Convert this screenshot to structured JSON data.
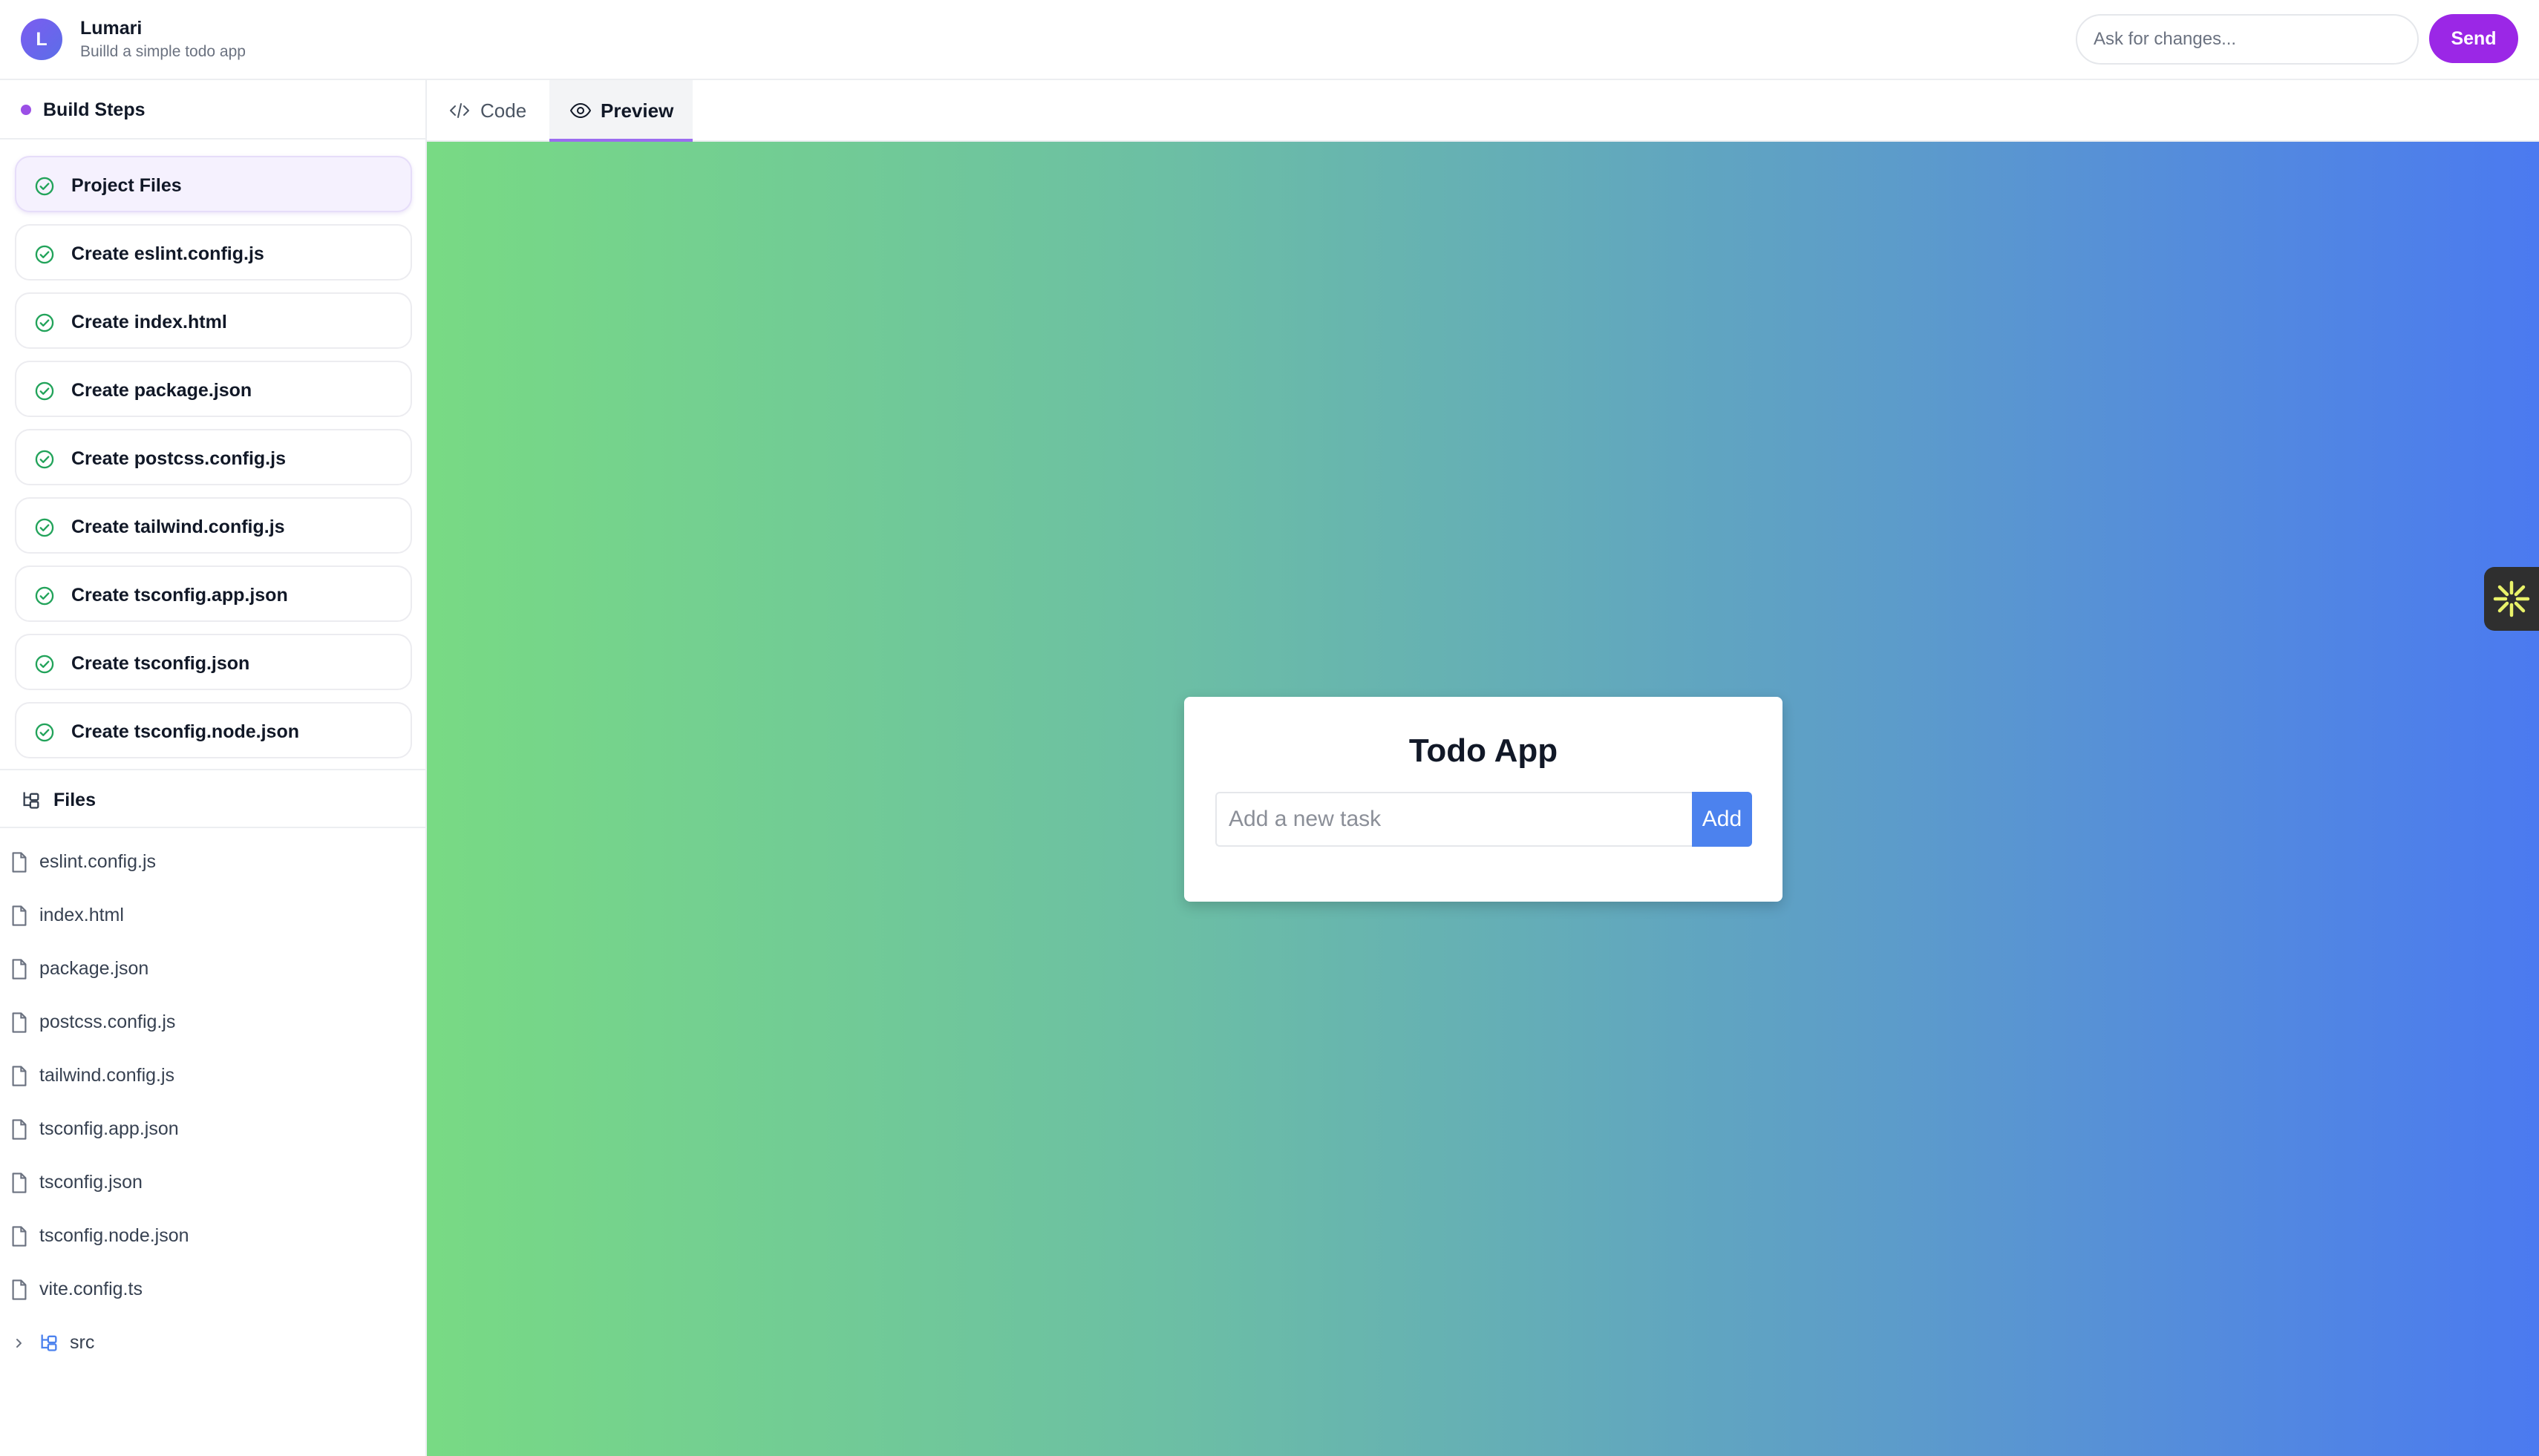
{
  "header": {
    "avatar_letter": "L",
    "app_name": "Lumari",
    "app_subtitle": "Builld a simple todo app",
    "ask_placeholder": "Ask for changes...",
    "send_label": "Send"
  },
  "build_steps": {
    "title": "Build Steps",
    "items": [
      {
        "label": "Project Files",
        "status": "done",
        "active": true
      },
      {
        "label": "Create eslint.config.js",
        "status": "done"
      },
      {
        "label": "Create index.html",
        "status": "done"
      },
      {
        "label": "Create package.json",
        "status": "done"
      },
      {
        "label": "Create postcss.config.js",
        "status": "done"
      },
      {
        "label": "Create tailwind.config.js",
        "status": "done"
      },
      {
        "label": "Create tsconfig.app.json",
        "status": "done"
      },
      {
        "label": "Create tsconfig.json",
        "status": "done"
      },
      {
        "label": "Create tsconfig.node.json",
        "status": "done"
      }
    ]
  },
  "files": {
    "title": "Files",
    "items": [
      {
        "name": "eslint.config.js",
        "icon": "file-icon"
      },
      {
        "name": "index.html",
        "icon": "file-icon"
      },
      {
        "name": "package.json",
        "icon": "file-icon"
      },
      {
        "name": "postcss.config.js",
        "icon": "file-icon"
      },
      {
        "name": "tailwind.config.js",
        "icon": "file-icon"
      },
      {
        "name": "tsconfig.app.json",
        "icon": "file-icon"
      },
      {
        "name": "tsconfig.json",
        "icon": "file-icon"
      },
      {
        "name": "tsconfig.node.json",
        "icon": "file-icon"
      },
      {
        "name": "vite.config.ts",
        "icon": "file-icon"
      }
    ],
    "folder": {
      "name": "src",
      "icon": "folder-tree-icon",
      "expanded": false
    }
  },
  "tabs": [
    {
      "label": "Code",
      "icon": "code-icon",
      "active": false
    },
    {
      "label": "Preview",
      "icon": "eye-icon",
      "active": true
    }
  ],
  "preview": {
    "card_title": "Todo App",
    "task_placeholder": "Add a new task",
    "add_label": "Add"
  },
  "colors": {
    "accent": "#9b27e6",
    "check": "#22a35a",
    "add_button": "#4c82ee",
    "gradient_start": "#78da84",
    "gradient_end": "#4b7af0"
  }
}
